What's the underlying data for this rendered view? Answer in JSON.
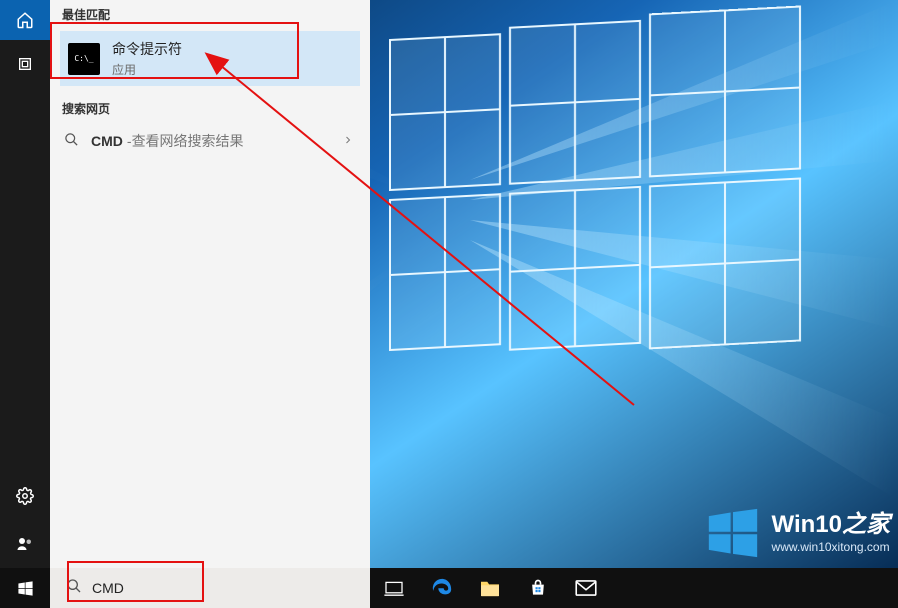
{
  "search": {
    "query": "CMD",
    "placeholder": ""
  },
  "panel": {
    "best_match_header": "最佳匹配",
    "best_match": {
      "title": "命令提示符",
      "subtitle": "应用",
      "icon_text": "C:\\_"
    },
    "web_header": "搜索网页",
    "web_result": {
      "primary": "CMD",
      "separator": " - ",
      "secondary": "查看网络搜索结果"
    }
  },
  "left_rail": {
    "home_icon": "home-icon",
    "filter_icon": "filter-icon",
    "settings_icon": "settings-icon",
    "feedback_icon": "feedback-icon"
  },
  "taskbar": {
    "start_icon": "windows-start-icon",
    "icons": [
      "task-view-icon",
      "edge-icon",
      "file-explorer-icon",
      "store-icon",
      "mail-icon"
    ]
  },
  "watermark": {
    "title_a": "Win10",
    "title_b": "之家",
    "url": "www.win10xitong.com"
  },
  "colors": {
    "accent": "#1766b8",
    "highlight_bg": "#d3e7f7",
    "annotation_red": "#e41111"
  }
}
